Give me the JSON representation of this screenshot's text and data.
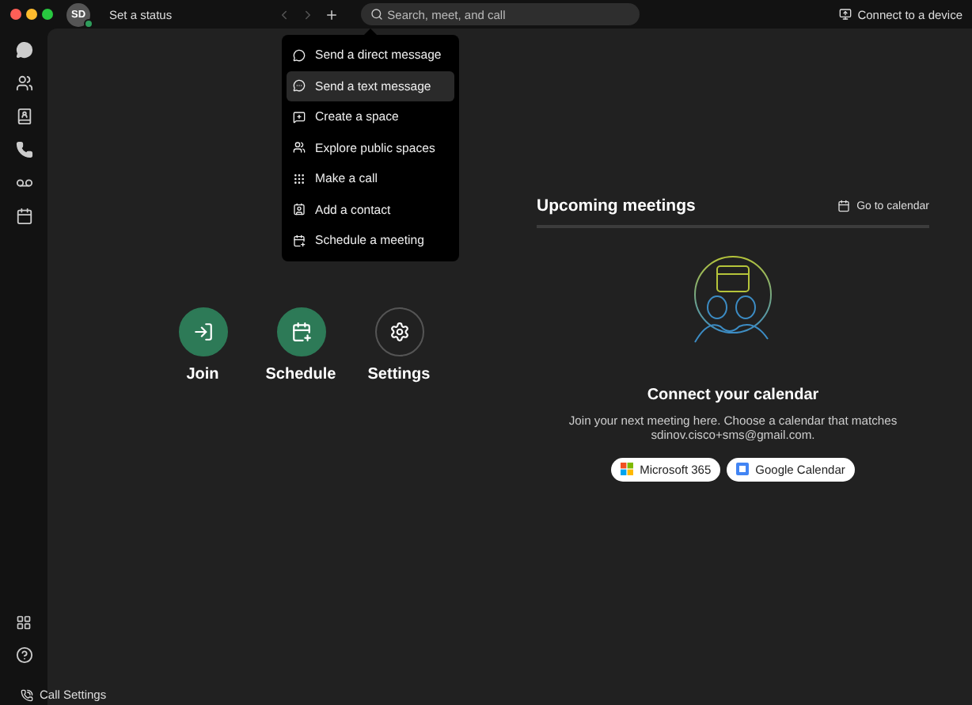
{
  "top_bar": {
    "avatar_initials": "SD",
    "status_label": "Set a status",
    "search": {
      "placeholder": "Search, meet, and call"
    },
    "device_button": "Connect to a device"
  },
  "new_menu": {
    "items": [
      {
        "kind": "direct",
        "label": "Send a direct message",
        "selected": false
      },
      {
        "kind": "text",
        "label": "Send a text message",
        "selected": true
      },
      {
        "kind": "space",
        "label": "Create a space",
        "selected": false
      },
      {
        "kind": "explore",
        "label": "Explore public spaces",
        "selected": false
      },
      {
        "kind": "call",
        "label": "Make a call",
        "selected": false
      },
      {
        "kind": "contact",
        "label": "Add a contact",
        "selected": false
      },
      {
        "kind": "meeting",
        "label": "Schedule a meeting",
        "selected": false
      }
    ]
  },
  "quick_actions": [
    {
      "kind": "join",
      "label": "Join"
    },
    {
      "kind": "schedule",
      "label": "Schedule"
    },
    {
      "kind": "settings",
      "label": "Settings"
    }
  ],
  "meetings": {
    "title": "Upcoming meetings",
    "calendar_link": "Go to calendar",
    "empty_title": "Connect your calendar",
    "empty_text": "Join your next meeting here. Choose a calendar that matches sdinov.cisco+sms@gmail.com.",
    "providers": [
      {
        "kind": "microsoft",
        "label": "Microsoft 365"
      },
      {
        "kind": "google",
        "label": "Google Calendar"
      }
    ]
  },
  "footer": {
    "call_settings": "Call Settings"
  }
}
